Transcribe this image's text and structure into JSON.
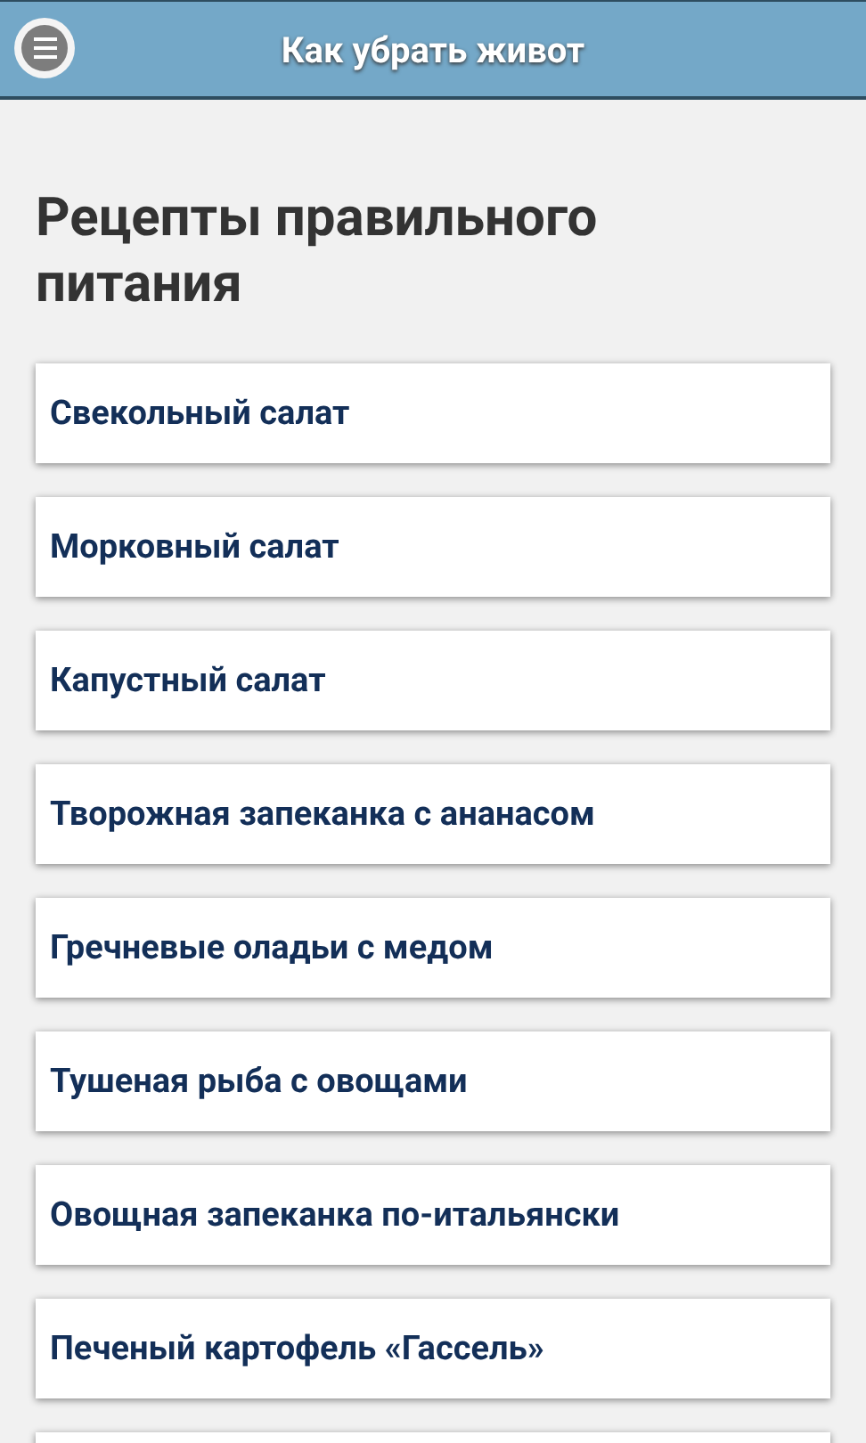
{
  "header": {
    "title": "Как убрать живот"
  },
  "heading": "Рецепты правильного питания",
  "items": [
    {
      "label": "Свекольный салат"
    },
    {
      "label": "Морковный салат"
    },
    {
      "label": "Капустный салат"
    },
    {
      "label": "Творожная запеканка с ананасом"
    },
    {
      "label": "Гречневые оладьи с медом"
    },
    {
      "label": "Тушеная рыба с овощами"
    },
    {
      "label": "Овощная запеканка по-итальянски"
    },
    {
      "label": "Печеный картофель «Гассель»"
    }
  ]
}
